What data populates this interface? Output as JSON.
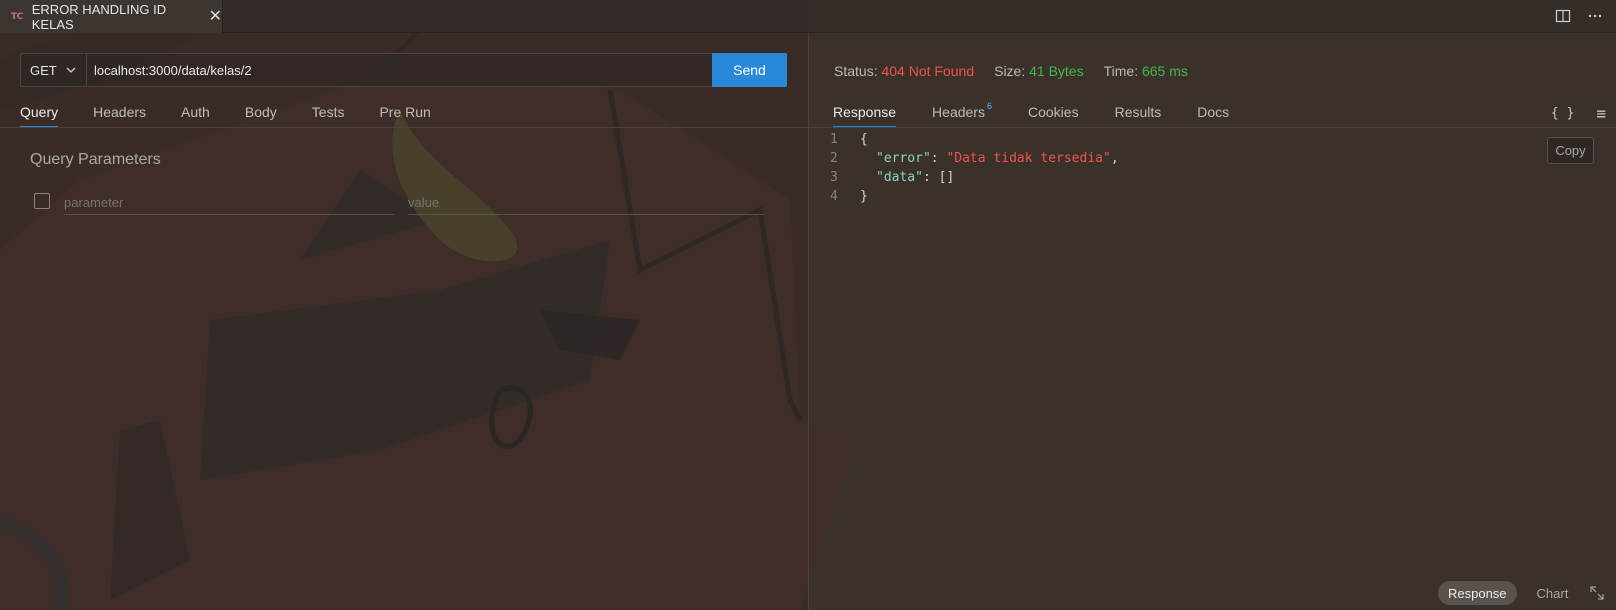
{
  "tab": {
    "badge": "TC",
    "title": "ERROR HANDLING ID KELAS",
    "close": "✕"
  },
  "top_icons": [
    "split-editor-icon",
    "more-icon"
  ],
  "request": {
    "method": "GET",
    "url": "localhost:3000/data/kelas/2",
    "send_label": "Send"
  },
  "left_tabs": [
    "Query",
    "Headers",
    "Auth",
    "Body",
    "Tests",
    "Pre Run"
  ],
  "query_params": {
    "title": "Query Parameters",
    "param_placeholder": "parameter",
    "value_placeholder": "value"
  },
  "status": {
    "status_label": "Status:",
    "status_value": "404 Not Found",
    "size_label": "Size:",
    "size_value": "41 Bytes",
    "time_label": "Time:",
    "time_value": "665 ms"
  },
  "right_tabs": {
    "response": "Response",
    "headers": "Headers",
    "headers_count": "6",
    "cookies": "Cookies",
    "results": "Results",
    "docs": "Docs"
  },
  "right_icons": {
    "braces": "{ }",
    "menu": "≡"
  },
  "response_body": {
    "lines": [
      "1",
      "2",
      "3",
      "4"
    ],
    "open_brace": "{",
    "key_error": "\"error\"",
    "val_error": "\"Data tidak tersedia\"",
    "key_data": "\"data\"",
    "val_data": "[]",
    "close_brace": "}"
  },
  "copy_label": "Copy",
  "bottom": {
    "response": "Response",
    "chart": "Chart"
  },
  "colors": {
    "accent": "#2b88d8",
    "error": "#f0524d",
    "success": "#46b64a"
  }
}
